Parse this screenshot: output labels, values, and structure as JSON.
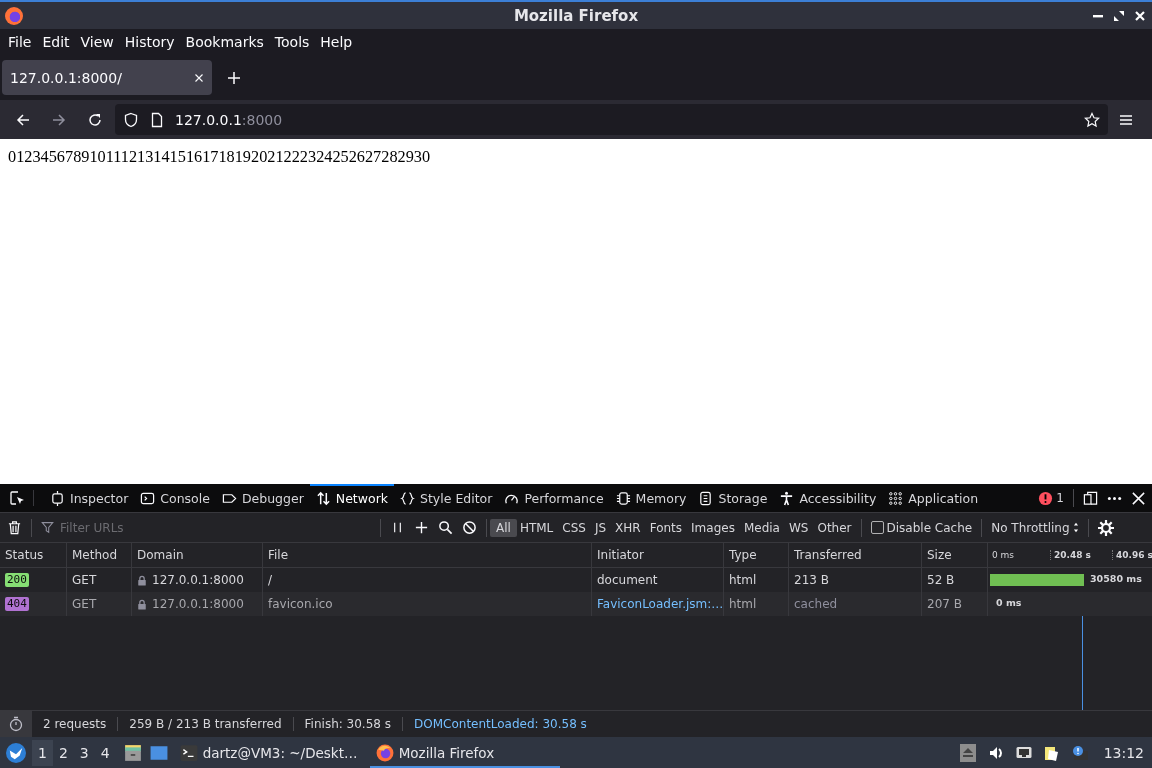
{
  "window": {
    "title": "Mozilla Firefox"
  },
  "menu": [
    {
      "label": "File"
    },
    {
      "label": "Edit"
    },
    {
      "label": "View"
    },
    {
      "label": "History"
    },
    {
      "label": "Bookmarks"
    },
    {
      "label": "Tools"
    },
    {
      "label": "Help"
    }
  ],
  "tabs": [
    {
      "label": "127.0.0.1:8000/",
      "selected": true
    }
  ],
  "address": {
    "host": "127.0.0.1",
    "port": ":8000"
  },
  "page": {
    "text": "0123456789101112131415161718192021222324252627282930"
  },
  "devtools": {
    "tabs": [
      {
        "label": "Inspector",
        "selected": false
      },
      {
        "label": "Console",
        "selected": false
      },
      {
        "label": "Debugger",
        "selected": false
      },
      {
        "label": "Network",
        "selected": true
      },
      {
        "label": "Style Editor",
        "selected": false
      },
      {
        "label": "Performance",
        "selected": false
      },
      {
        "label": "Memory",
        "selected": false
      },
      {
        "label": "Storage",
        "selected": false
      },
      {
        "label": "Accessibility",
        "selected": false
      },
      {
        "label": "Application",
        "selected": false
      }
    ],
    "error_count": "1",
    "filter": {
      "placeholder": "Filter URLs"
    },
    "type_filters": [
      {
        "label": "All",
        "selected": true
      },
      {
        "label": "HTML",
        "selected": false
      },
      {
        "label": "CSS",
        "selected": false
      },
      {
        "label": "JS",
        "selected": false
      },
      {
        "label": "XHR",
        "selected": false
      },
      {
        "label": "Fonts",
        "selected": false
      },
      {
        "label": "Images",
        "selected": false
      },
      {
        "label": "Media",
        "selected": false
      },
      {
        "label": "WS",
        "selected": false
      },
      {
        "label": "Other",
        "selected": false
      }
    ],
    "disable_cache": {
      "label": "Disable Cache",
      "checked": false
    },
    "throttling": "No Throttling",
    "table": {
      "columns": [
        "Status",
        "Method",
        "Domain",
        "File",
        "Initiator",
        "Type",
        "Transferred",
        "Size"
      ],
      "timeline_ticks": [
        "0 ms",
        "20.48 s",
        "40.96 s"
      ],
      "rows": [
        {
          "status": "200",
          "color": "#86de74",
          "method": "GET",
          "domain": "127.0.0.1:8000",
          "file": "/",
          "initiator": "document",
          "initiator_link": false,
          "type": "html",
          "transferred": "213 B",
          "transferred_cached": false,
          "size": "52 B",
          "timing": "30580 ms",
          "level": 0.58
        },
        {
          "status": "404",
          "color": "#b072d1",
          "method": "GET",
          "domain": "127.0.0.1:8000",
          "file": "favicon.ico",
          "initiator": "FaviconLoader.jsm:…",
          "initiator_link": true,
          "type": "html",
          "transferred": "cached",
          "transferred_cached": true,
          "size": "207 B",
          "timing": "0 ms"
        }
      ]
    },
    "status_bar": {
      "requests": "2 requests",
      "transferred": "259 B / 213 B transferred",
      "finish": "Finish: 30.58 s",
      "dom_loaded": "DOMContentLoaded: 30.58 s"
    }
  },
  "taskbar": {
    "workspaces": [
      {
        "label": "1",
        "selected": true
      },
      {
        "label": "2",
        "selected": false
      },
      {
        "label": "3",
        "selected": false
      },
      {
        "label": "4",
        "selected": false
      }
    ],
    "tasks": [
      {
        "label": "dartz@VM3: ~/Deskt…",
        "kind": "terminal",
        "selected": false
      },
      {
        "label": "Mozilla Firefox",
        "kind": "browser",
        "selected": true
      }
    ],
    "clock": "13:12"
  }
}
